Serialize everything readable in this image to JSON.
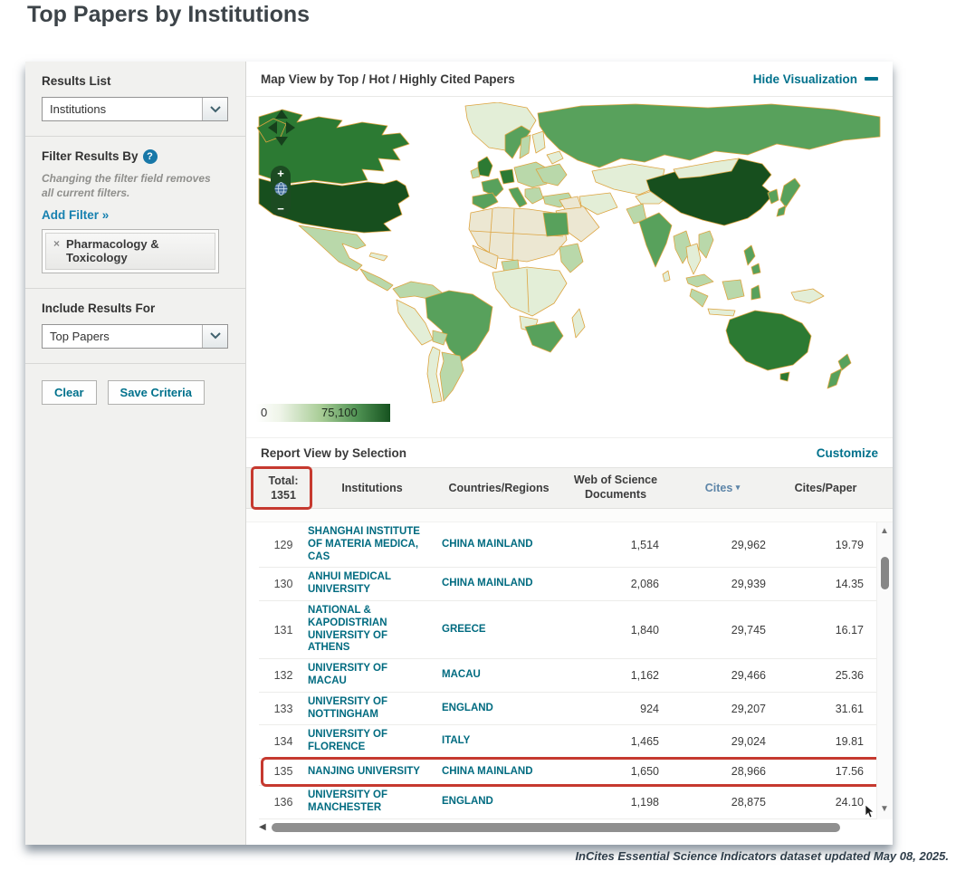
{
  "page": {
    "title": "Top Papers by Institutions",
    "footer_note": "InCites Essential Science Indicators dataset updated May 08, 2025."
  },
  "sidebar": {
    "results_list": {
      "label": "Results List",
      "selected": "Institutions"
    },
    "filter": {
      "label": "Filter Results By",
      "help_icon": "?",
      "note": "Changing the filter field removes all current filters.",
      "add_filter_label": "Add Filter »",
      "tag": {
        "remove_icon": "×",
        "label": "Pharmacology & Toxicology"
      }
    },
    "include_results": {
      "label": "Include Results For",
      "selected": "Top Papers"
    },
    "buttons": {
      "clear": "Clear",
      "save": "Save Criteria"
    }
  },
  "map": {
    "header": "Map View by Top / Hot / Highly Cited Papers",
    "hide_visualization_label": "Hide Visualization",
    "legend": {
      "min": "0",
      "max": "75,100"
    },
    "controls": {
      "zoom_in": "+",
      "zoom_out": "−"
    }
  },
  "report": {
    "header": "Report View by Selection",
    "customize_label": "Customize",
    "total": {
      "label": "Total:",
      "value": "1351"
    },
    "columns": {
      "institutions": "Institutions",
      "countries": "Countries/Regions",
      "documents": "Web of Science Documents",
      "cites": "Cites",
      "cites_sort_icon": "▾",
      "cites_per_paper": "Cites/Paper"
    },
    "rows": [
      {
        "rank": "129",
        "institution": "SHANGHAI INSTITUTE OF MATERIA MEDICA, CAS",
        "country": "CHINA MAINLAND",
        "documents": "1,514",
        "cites": "29,962",
        "cites_per_paper": "19.79",
        "highlighted": false
      },
      {
        "rank": "130",
        "institution": "ANHUI MEDICAL UNIVERSITY",
        "country": "CHINA MAINLAND",
        "documents": "2,086",
        "cites": "29,939",
        "cites_per_paper": "14.35",
        "highlighted": false
      },
      {
        "rank": "131",
        "institution": "NATIONAL & KAPODISTRIAN UNIVERSITY OF ATHENS",
        "country": "GREECE",
        "documents": "1,840",
        "cites": "29,745",
        "cites_per_paper": "16.17",
        "highlighted": false
      },
      {
        "rank": "132",
        "institution": "UNIVERSITY OF MACAU",
        "country": "MACAU",
        "documents": "1,162",
        "cites": "29,466",
        "cites_per_paper": "25.36",
        "highlighted": false
      },
      {
        "rank": "133",
        "institution": "UNIVERSITY OF NOTTINGHAM",
        "country": "ENGLAND",
        "documents": "924",
        "cites": "29,207",
        "cites_per_paper": "31.61",
        "highlighted": false
      },
      {
        "rank": "134",
        "institution": "UNIVERSITY OF FLORENCE",
        "country": "ITALY",
        "documents": "1,465",
        "cites": "29,024",
        "cites_per_paper": "19.81",
        "highlighted": false
      },
      {
        "rank": "135",
        "institution": "NANJING UNIVERSITY",
        "country": "CHINA MAINLAND",
        "documents": "1,650",
        "cites": "28,966",
        "cites_per_paper": "17.56",
        "highlighted": true
      },
      {
        "rank": "136",
        "institution": "UNIVERSITY OF MANCHESTER",
        "country": "ENGLAND",
        "documents": "1,198",
        "cites": "28,875",
        "cites_per_paper": "24.10",
        "highlighted": false
      }
    ]
  },
  "colors": {
    "accent_teal": "#00718c",
    "annotation_red": "#c6392f",
    "cites_header_blue": "#5d85a8",
    "map_dark_green": "#1c4b22",
    "legend_max_green": "#16521f"
  }
}
